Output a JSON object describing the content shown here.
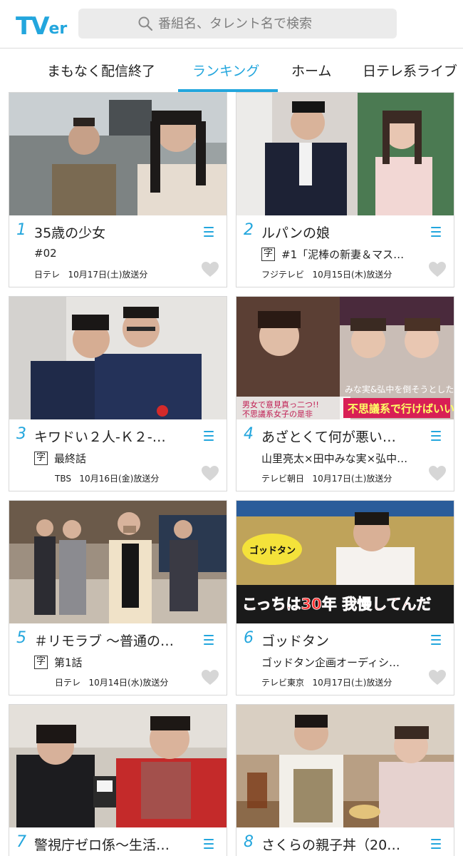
{
  "header": {
    "logo_main": "TV",
    "logo_sub": "er",
    "search_placeholder": "番組名、タレント名で検索"
  },
  "tabs": [
    {
      "label": "まもなく配信終了",
      "active": false
    },
    {
      "label": "ランキング",
      "active": true
    },
    {
      "label": "ホーム",
      "active": false
    },
    {
      "label": "日テレ系ライブ",
      "active": false
    }
  ],
  "accent_color": "#23a6dd",
  "ranking": [
    {
      "rank": "1",
      "title": "35歳の少女",
      "subtitle": "#02",
      "subtitles_cc": false,
      "channel": "日テレ",
      "air_date": "10月17日(土)放送分"
    },
    {
      "rank": "2",
      "title": "ルパンの娘",
      "subtitle": "#1「泥棒の新妻＆マス…",
      "subtitles_cc": true,
      "cc_label": "字",
      "channel": "フジテレビ",
      "air_date": "10月15日(木)放送分"
    },
    {
      "rank": "3",
      "title": "キワドい２人-Ｋ２-…",
      "subtitle": "最終話",
      "subtitles_cc": true,
      "cc_label": "字",
      "channel": "TBS",
      "air_date": "10月16日(金)放送分"
    },
    {
      "rank": "4",
      "title": "あざとくて何が悪い…",
      "subtitle": "山里亮太×田中みな実×弘中…",
      "subtitles_cc": false,
      "channel": "テレビ朝日",
      "air_date": "10月17日(土)放送分"
    },
    {
      "rank": "5",
      "title": "＃リモラブ ～普通の…",
      "subtitle": "第1話",
      "subtitles_cc": true,
      "cc_label": "字",
      "channel": "日テレ",
      "air_date": "10月14日(水)放送分"
    },
    {
      "rank": "6",
      "title": "ゴッドタン",
      "subtitle": "ゴッドタン企画オーディシ…",
      "subtitles_cc": false,
      "channel": "テレビ東京",
      "air_date": "10月17日(土)放送分"
    },
    {
      "rank": "7",
      "title": "警視庁ゼロ係～生活…",
      "subtitle": "",
      "subtitles_cc": false,
      "channel": "",
      "air_date": ""
    },
    {
      "rank": "8",
      "title": "さくらの親子丼（20…",
      "subtitle": "",
      "subtitles_cc": false,
      "channel": "",
      "air_date": ""
    }
  ],
  "thumbnail_captions": {
    "card4_line1": "男女で意見真っ二つ!!",
    "card4_line2": "不思議系女子の是非",
    "card4_banner": "不思議系で行けばいい",
    "card4_overlay": "みな実&弘中を倒そうとしたら",
    "card6_banner": "こっちは30年 我慢してんだ",
    "card6_logo": "ゴッドタン"
  }
}
